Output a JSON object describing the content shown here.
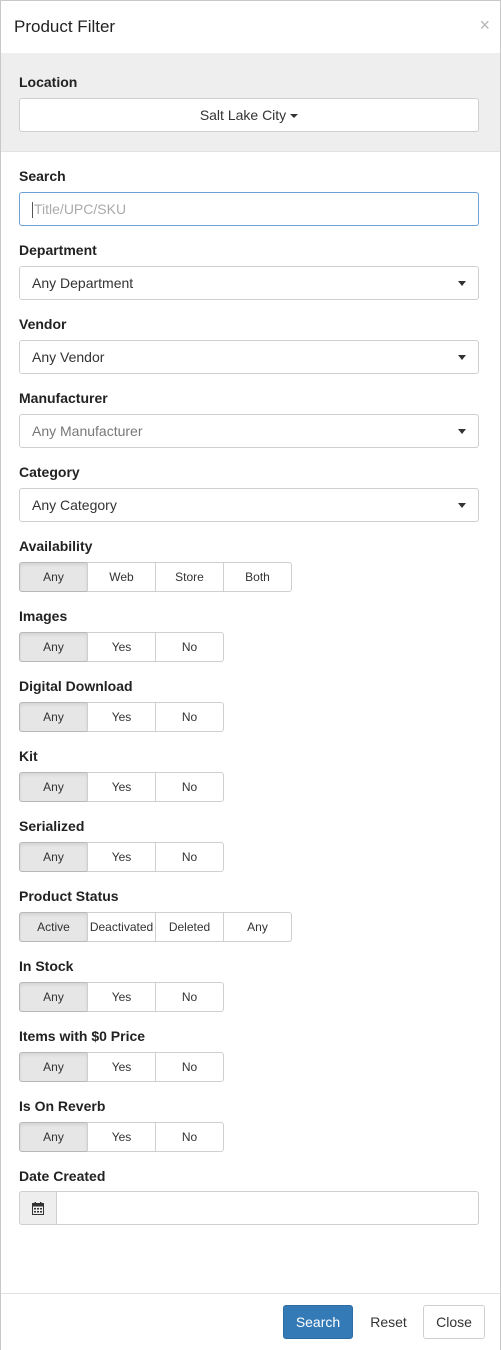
{
  "header": {
    "title": "Product Filter",
    "close_glyph": "×"
  },
  "location": {
    "label": "Location",
    "value": "Salt Lake City"
  },
  "search": {
    "label": "Search",
    "placeholder": "Title/UPC/SKU"
  },
  "department": {
    "label": "Department",
    "value": "Any Department"
  },
  "vendor": {
    "label": "Vendor",
    "value": "Any Vendor"
  },
  "manufacturer": {
    "label": "Manufacturer",
    "value": "Any Manufacturer"
  },
  "category": {
    "label": "Category",
    "value": "Any Category"
  },
  "availability": {
    "label": "Availability",
    "options": [
      "Any",
      "Web",
      "Store",
      "Both"
    ],
    "selected": "Any"
  },
  "images": {
    "label": "Images",
    "options": [
      "Any",
      "Yes",
      "No"
    ],
    "selected": "Any"
  },
  "digital_download": {
    "label": "Digital Download",
    "options": [
      "Any",
      "Yes",
      "No"
    ],
    "selected": "Any"
  },
  "kit": {
    "label": "Kit",
    "options": [
      "Any",
      "Yes",
      "No"
    ],
    "selected": "Any"
  },
  "serialized": {
    "label": "Serialized",
    "options": [
      "Any",
      "Yes",
      "No"
    ],
    "selected": "Any"
  },
  "product_status": {
    "label": "Product Status",
    "options": [
      "Active",
      "Deactivated",
      "Deleted",
      "Any"
    ],
    "selected": "Active"
  },
  "in_stock": {
    "label": "In Stock",
    "options": [
      "Any",
      "Yes",
      "No"
    ],
    "selected": "Any"
  },
  "zero_price": {
    "label": "Items with $0 Price",
    "options": [
      "Any",
      "Yes",
      "No"
    ],
    "selected": "Any"
  },
  "on_reverb": {
    "label": "Is On Reverb",
    "options": [
      "Any",
      "Yes",
      "No"
    ],
    "selected": "Any"
  },
  "date_created": {
    "label": "Date Created",
    "value": "",
    "icon": "calendar-icon"
  },
  "footer": {
    "search_label": "Search",
    "reset_label": "Reset",
    "close_label": "Close"
  },
  "colors": {
    "primary": "#337ab7",
    "active_segment": "#e6e6e6",
    "band": "#eeeeee"
  }
}
